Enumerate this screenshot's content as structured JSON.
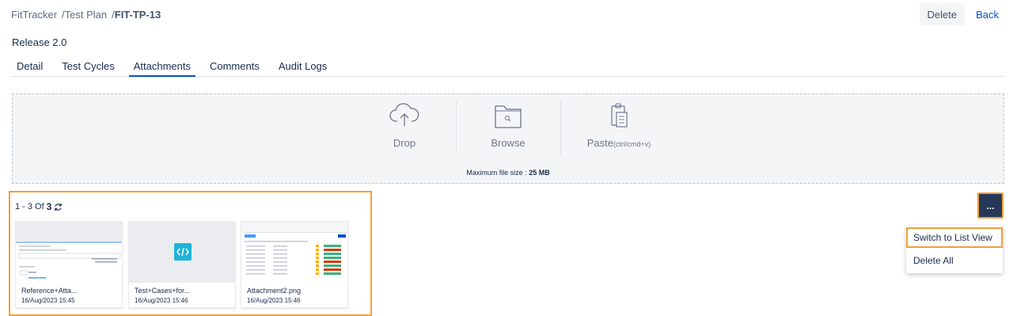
{
  "breadcrumb": {
    "project": "FitTracker",
    "section": "/Test Plan",
    "sep": "/",
    "current": "FIT-TP-13"
  },
  "header": {
    "delete_label": "Delete",
    "back_label": "Back"
  },
  "release": "Release 2.0",
  "tabs": [
    {
      "label": "Detail",
      "active": false
    },
    {
      "label": "Test Cycles",
      "active": false
    },
    {
      "label": "Attachments",
      "active": true
    },
    {
      "label": "Comments",
      "active": false
    },
    {
      "label": "Audit Logs",
      "active": false
    }
  ],
  "upload": {
    "drop_label": "Drop",
    "browse_label": "Browse",
    "paste_label": "Paste",
    "paste_hint": "(ctrl/cmd+v)",
    "max_size_label": "Maximum file size :",
    "max_size_value": "25 MB",
    "icons": [
      "cloud-upload-icon",
      "folder-icon",
      "clipboard-icon"
    ]
  },
  "attachments": {
    "range": "1 - 3",
    "of_label": "Of",
    "total": "3",
    "items": [
      {
        "name": "Reference+Atta...",
        "date": "16/Aug/2023 15:45"
      },
      {
        "name": "Test+Cases+for...",
        "date": "16/Aug/2023 15:46"
      },
      {
        "name": "Attachment2.png",
        "date": "16/Aug/2023 15:46"
      }
    ]
  },
  "more_menu": {
    "button_label": "...",
    "items": [
      {
        "label": "Switch to List View"
      },
      {
        "label": "Delete All"
      }
    ]
  },
  "colors": {
    "accent": "#0052cc",
    "highlight": "#f29f37",
    "dark_button": "#253858",
    "code_icon": "#1fb5d8"
  }
}
